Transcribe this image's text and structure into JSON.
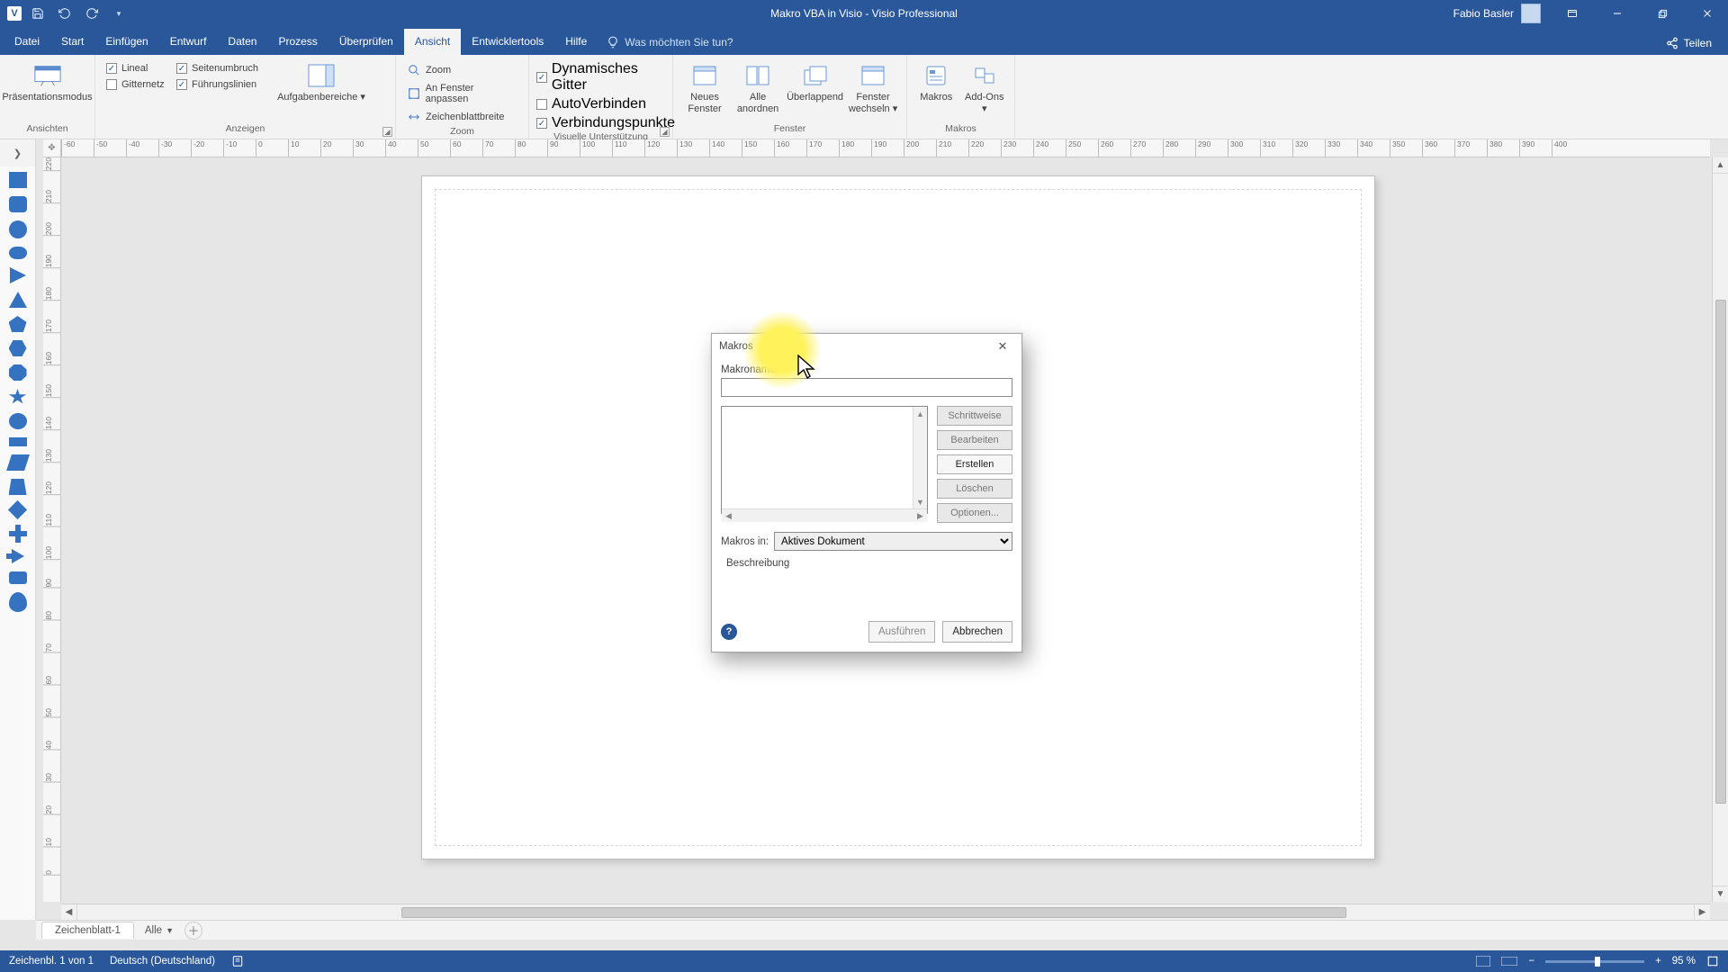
{
  "titlebar": {
    "doc_title": "Makro VBA in Visio",
    "app_name": "Visio Professional",
    "separator": "  -  ",
    "user_name": "Fabio Basler"
  },
  "tabs": {
    "items": [
      "Datei",
      "Start",
      "Einfügen",
      "Entwurf",
      "Daten",
      "Prozess",
      "Überprüfen",
      "Ansicht",
      "Entwicklertools",
      "Hilfe"
    ],
    "active_index": 7,
    "tell_me": "Was möchten Sie tun?",
    "share": "Teilen"
  },
  "ribbon": {
    "group_ansichten": {
      "label": "Ansichten",
      "presentation": "Präsentationsmodus"
    },
    "group_anzeigen": {
      "label": "Anzeigen",
      "lineal": "Lineal",
      "seitenumbruch": "Seitenumbruch",
      "gitternetz": "Gitternetz",
      "fuehrung": "Führungslinien",
      "aufgaben": "Aufgabenbereiche",
      "lineal_checked": true,
      "seitenumbruch_checked": true,
      "gitternetz_checked": false,
      "fuehrung_checked": true
    },
    "group_zoom": {
      "label": "Zoom",
      "zoom": "Zoom",
      "fit": "An Fenster anpassen",
      "width": "Zeichenblattbreite"
    },
    "group_visuell": {
      "label": "Visuelle Unterstützung",
      "dyn": "Dynamisches Gitter",
      "auto": "AutoVerbinden",
      "conn": "Verbindungspunkte",
      "dyn_checked": true,
      "auto_checked": false,
      "conn_checked": true
    },
    "group_fenster": {
      "label": "Fenster",
      "neu": "Neues Fenster",
      "alle": "Alle anordnen",
      "ueber": "Überlappend",
      "wechseln": "Fenster wechseln"
    },
    "group_makros": {
      "label": "Makros",
      "makros": "Makros",
      "addons": "Add-Ons"
    }
  },
  "pagetabs": {
    "sheet": "Zeichenblatt-1",
    "all": "Alle"
  },
  "status": {
    "page_info": "Zeichenbl. 1 von 1",
    "language": "Deutsch (Deutschland)",
    "zoom": "95 %"
  },
  "dialog": {
    "title": "Makros",
    "name_label": "Makroname:",
    "name_value": "",
    "btn_step": "Schrittweise",
    "btn_edit": "Bearbeiten",
    "btn_create": "Erstellen",
    "btn_delete": "Löschen",
    "btn_options": "Optionen...",
    "in_label": "Makros in:",
    "in_value": "Aktives Dokument",
    "desc_label": "Beschreibung",
    "run": "Ausführen",
    "cancel": "Abbrechen"
  },
  "ruler": {
    "h_start": -60,
    "h_end": 400,
    "h_step": 10,
    "v_start": 0,
    "v_end": 300,
    "v_step": 10
  }
}
